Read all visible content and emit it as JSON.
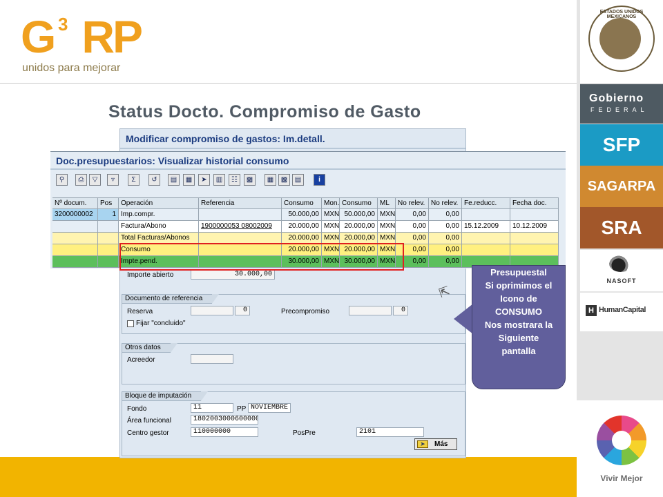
{
  "logo": {
    "main": "G",
    "sup": "3",
    "rest": "RP",
    "tagline": "unidos para mejorar"
  },
  "slide_title": "Status Docto. Compromiso de Gasto",
  "sidebar": {
    "seal_text": "ESTADOS UNIDOS MEXICANOS",
    "gobierno_line1": "Gobierno",
    "gobierno_line2": "FEDERAL",
    "sfp": "SFP",
    "sagarpa": "SAGARPA",
    "sra": "SRA",
    "nasoft": "NASOFT",
    "human_icon": "H",
    "humancapital": "HumanCapital",
    "vivir": "Vivir Mejor"
  },
  "background_window": {
    "title": "Modificar compromiso de gastos: Im.detall.",
    "importe_abierto_label": "Importe abierto",
    "importe_abierto_value": "30.000,00",
    "doc_ref": {
      "group_title": "Documento de referencia",
      "reserva_label": "Reserva",
      "reserva_value": "0",
      "precompromiso_label": "Precompromiso",
      "precompromiso_value": "0",
      "fijar_label": "Fijar \"concluido\""
    },
    "otros": {
      "group_title": "Otros datos",
      "acreedor_label": "Acreedor"
    },
    "bloque": {
      "group_title": "Bloque de imputación",
      "fondo_label": "Fondo",
      "fondo_value": "11",
      "pp_label": "PP",
      "pp_value": "NOVIEMBRE",
      "area_label": "Área funcional",
      "area_value": "1802003000600000",
      "centro_label": "Centro gestor",
      "centro_value": "110000000",
      "pospre_label": "PosPre",
      "pospre_value": "2101",
      "mas_label": "Más"
    }
  },
  "front_window": {
    "title": "Doc.presupuestarios: Visualizar historial consumo",
    "toolbar_icons": [
      "zoom-icon",
      "print-icon",
      "filter-icon",
      "set-filter-icon",
      "sum-icon",
      "layout-icon",
      "export-icon",
      "spreadsheet-icon",
      "send-icon",
      "word-icon",
      "abc-icon",
      "graph-icon",
      "grid-icon",
      "grid2-icon",
      "grid3-icon",
      "info-icon"
    ],
    "info_glyph": "i",
    "headers": [
      "Nº docum.",
      "Pos",
      "Operación",
      "Referencia",
      "Consumo",
      "Mon.",
      "Consumo",
      "ML",
      "No relev.",
      "No relev.",
      "Fe.reducc.",
      "Fecha doc."
    ],
    "rows": [
      [
        "3200000002",
        "1",
        "Imp.compr.",
        "",
        "50.000,00",
        "MXN",
        "50.000,00",
        "MXN",
        "0,00",
        "0,00",
        "",
        ""
      ],
      [
        "",
        "",
        "Factura/Abono",
        "1900000053 08002009",
        "20.000,00",
        "MXN",
        "20.000,00",
        "MXN",
        "0,00",
        "0,00",
        "15.12.2009",
        "10.12.2009"
      ],
      [
        "",
        "",
        "Total Facturas/Abonos",
        "",
        "20.000,00",
        "MXN",
        "20.000,00",
        "MXN",
        "0,00",
        "0,00",
        "",
        ""
      ],
      [
        "",
        "",
        "Consumo",
        "",
        "20.000,00",
        "MXN",
        "20.000,00",
        "MXN",
        "0,00",
        "0,00",
        "",
        ""
      ],
      [
        "",
        "",
        "Impte.pend.",
        "",
        "30.000,00",
        "MXN",
        "30.000,00",
        "MXN",
        "0,00",
        "0,00",
        "",
        ""
      ]
    ]
  },
  "callout": {
    "lines": [
      "Presupuestal",
      "Si oprimimos el",
      "Icono de",
      "CONSUMO",
      "Nos mostrara la",
      "Siguiente",
      "pantalla"
    ]
  },
  "colors": {
    "brand_orange": "#f0a01e",
    "footer_yellow": "#f2b400",
    "sap_title": "#1c3c80",
    "highlight_red": "#e02020",
    "callout_purple": "#615f9c",
    "row_green": "#5cbf5c",
    "row_yellow": "#fff080"
  }
}
